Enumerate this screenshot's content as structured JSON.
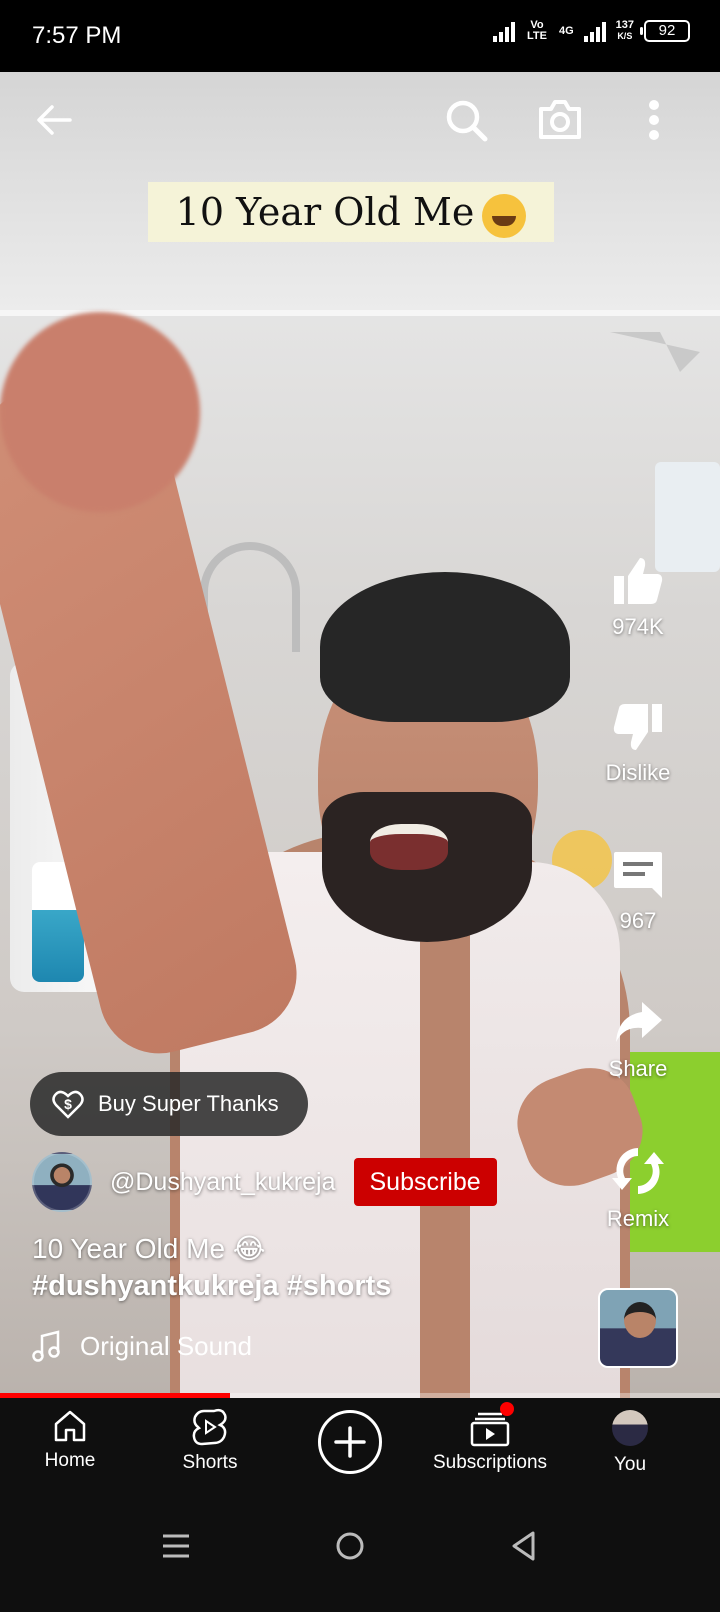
{
  "status": {
    "time": "7:57 PM",
    "volte": "Vo LTE",
    "network": "4G",
    "speed_value": "137",
    "speed_unit": "K/S",
    "battery": "92"
  },
  "video": {
    "caption_banner": "10 Year Old Me"
  },
  "actions": {
    "like_count": "974K",
    "dislike_label": "Dislike",
    "comment_count": "967",
    "share_label": "Share",
    "remix_label": "Remix"
  },
  "super_thanks": {
    "label": "Buy Super Thanks"
  },
  "channel": {
    "handle": "@Dushyant_kukreja",
    "subscribe_label": "Subscribe"
  },
  "description": {
    "title": "10 Year Old Me 😂",
    "tags": "#dushyantkukreja #shorts"
  },
  "sound": {
    "label": "Original Sound"
  },
  "playback": {
    "progress_fraction": 0.32
  },
  "bottom_nav": {
    "items": [
      {
        "label": "Home",
        "icon": "home-icon"
      },
      {
        "label": "Shorts",
        "icon": "shorts-icon"
      },
      {
        "label": "",
        "icon": "create-icon"
      },
      {
        "label": "Subscriptions",
        "icon": "subscriptions-icon"
      },
      {
        "label": "You",
        "icon": "avatar"
      }
    ]
  },
  "colors": {
    "subscribe_red": "#cc0000",
    "progress_red": "#ff0000",
    "nav_background": "#0f0f0f"
  }
}
